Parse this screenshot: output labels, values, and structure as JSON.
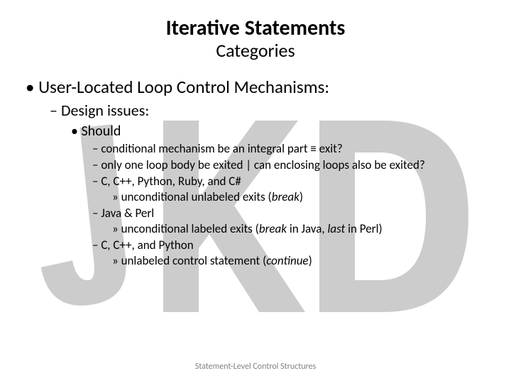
{
  "title": "Iterative Statements",
  "subtitle": "Categories",
  "bullet1": "User-Located Loop Control Mechanisms:",
  "bullet2": "Design issues:",
  "bullet3": "Should",
  "items": {
    "a": "conditional mechanism be an integral part ≡ exit?",
    "b": "only one loop body be exited | can enclosing loops also be exited?",
    "c": "C, C++, Python, Ruby, and C#",
    "c_sub_pre": "unconditional unlabeled exits (",
    "c_sub_it": "break",
    "c_sub_post": ")",
    "d": "Java & Perl",
    "d_sub_pre": "unconditional labeled exits (",
    "d_sub_it1": "break",
    "d_sub_mid": " in Java, ",
    "d_sub_it2": "last",
    "d_sub_post": " in Perl)",
    "e": "C, C++, and Python",
    "e_sub_pre": "unlabeled control statement (",
    "e_sub_it": "continue",
    "e_sub_post": ")"
  },
  "footer": "Statement-Level Control Structures"
}
